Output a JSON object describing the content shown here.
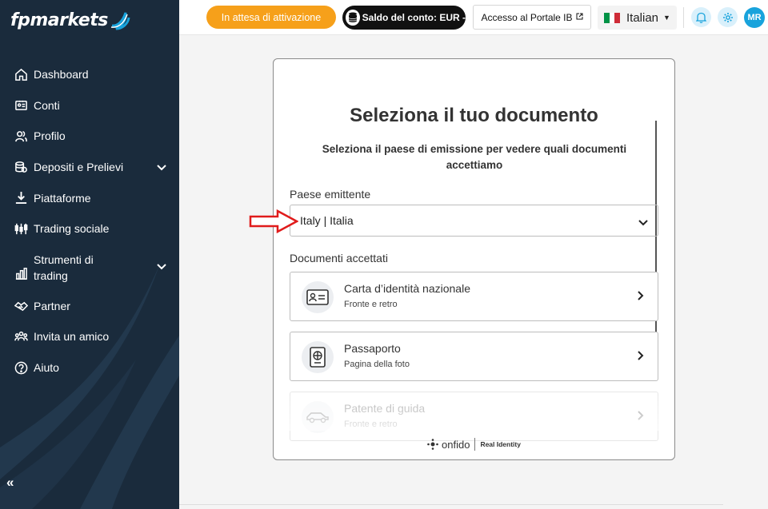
{
  "brand": {
    "name": "fpmarkets",
    "accent": "#18a3dc",
    "sidebar_bg": "#1a2b3c"
  },
  "sidebar": {
    "items": [
      {
        "label": "Dashboard",
        "icon": "home-icon"
      },
      {
        "label": "Conti",
        "icon": "id-card-icon"
      },
      {
        "label": "Profilo",
        "icon": "users-icon"
      },
      {
        "label": "Depositi e Prelievi",
        "icon": "coins-icon",
        "expandable": true
      },
      {
        "label": "Piattaforme",
        "icon": "download-icon"
      },
      {
        "label": "Trading sociale",
        "icon": "social-trading-icon"
      },
      {
        "label": "Strumenti di trading",
        "icon": "bar-chart-icon",
        "expandable": true
      },
      {
        "label": "Partner",
        "icon": "handshake-icon"
      },
      {
        "label": "Invita un amico",
        "icon": "group-icon"
      },
      {
        "label": "Aiuto",
        "icon": "help-icon"
      }
    ],
    "collapse_label": "«"
  },
  "topbar": {
    "status_label": "In attesa di attivazione",
    "status_color": "#f6a01a",
    "balance_label": "Saldo del conto: EUR -",
    "portal_label": "Accesso al Portale IB",
    "language": "Italian",
    "avatar_initials": "MR"
  },
  "modal": {
    "title": "Seleziona il tuo documento",
    "subtitle": "Seleziona il paese di emissione per vedere quali documenti accettiamo",
    "country_label": "Paese emittente",
    "country_value": "Italy | Italia",
    "docs_label": "Documenti accettati",
    "documents": [
      {
        "title": "Carta d’identità nazionale",
        "desc": "Fronte e retro",
        "icon": "id-card-icon"
      },
      {
        "title": "Passaporto",
        "desc": "Pagina della foto",
        "icon": "passport-icon"
      },
      {
        "title": "Patente di guida",
        "desc": "Fronte e retro",
        "icon": "car-icon"
      }
    ],
    "footer_brand": "onfido",
    "footer_tag": "Real Identity"
  }
}
